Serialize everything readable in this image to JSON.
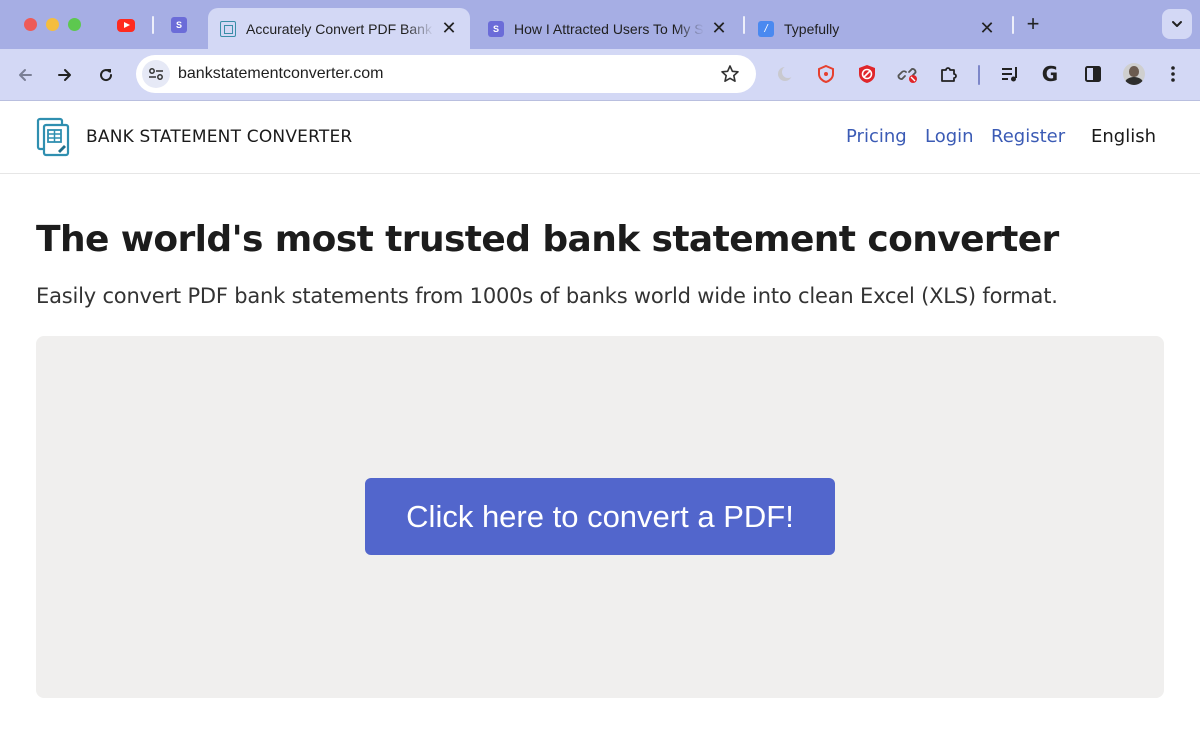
{
  "browser": {
    "tabs": [
      {
        "title": "",
        "icon": "youtube-icon"
      },
      {
        "title": "",
        "icon": "s-favicon-icon",
        "glyph": "S"
      },
      {
        "title": "Accurately Convert PDF Bank Statements",
        "icon": "doc-favicon-icon",
        "active": true,
        "close": "✕"
      },
      {
        "title": "How I Attracted Users To My SaaS",
        "icon": "s-favicon-icon",
        "glyph": "S",
        "close": "✕"
      },
      {
        "title": "Typefully",
        "icon": "typefully-favicon-icon",
        "glyph": "/",
        "close": "✕"
      }
    ],
    "new_tab": "+",
    "address": {
      "url": "bankstatementconverter.com"
    },
    "accent": "#a6aee4",
    "toolbar_bg": "#d3d8f5"
  },
  "site": {
    "brand": "BANK STATEMENT CONVERTER",
    "nav": {
      "pricing": "Pricing",
      "login": "Login",
      "register": "Register",
      "language": "English"
    },
    "headline": "The world's most trusted bank statement converter",
    "subheadline": "Easily convert PDF bank statements from 1000s of banks world wide into clean Excel (XLS) format.",
    "cta": "Click here to convert a PDF!",
    "colors": {
      "link": "#3b5bb5",
      "cta": "#5266cc",
      "dropzone": "#f0efee"
    }
  }
}
